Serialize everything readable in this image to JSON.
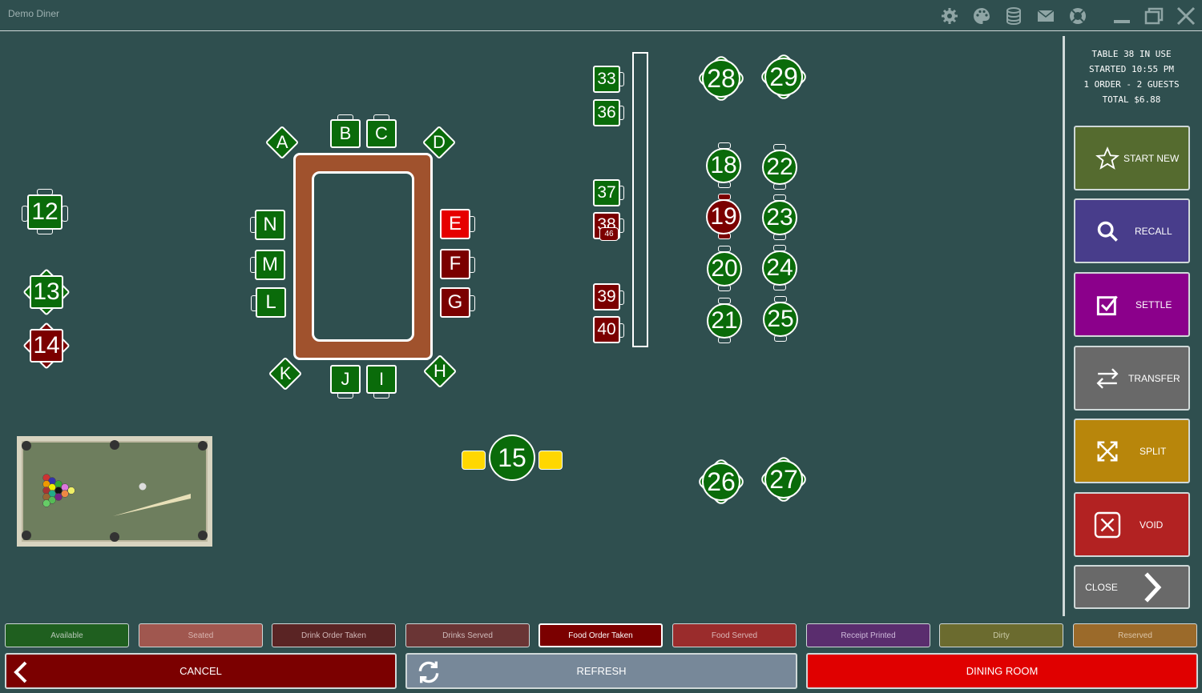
{
  "app": {
    "title": "Demo Diner"
  },
  "titlebar": {
    "icons": [
      "gear-icon",
      "palette-icon",
      "database-icon",
      "mail-icon",
      "lifebuoy-icon",
      "minimize-icon",
      "maximize-icon",
      "close-icon"
    ]
  },
  "floor": {
    "bar_tables": {
      "A": "A",
      "B": "B",
      "C": "C",
      "D": "D",
      "E": "E",
      "F": "F",
      "G": "G",
      "H": "H",
      "I": "I",
      "J": "J",
      "K": "K",
      "L": "L",
      "M": "M",
      "N": "N"
    },
    "tables": {
      "t12": "12",
      "t13": "13",
      "t14": "14",
      "t15": "15",
      "t18": "18",
      "t19": "19",
      "t20": "20",
      "t21": "21",
      "t22": "22",
      "t23": "23",
      "t24": "24",
      "t25": "25",
      "t26": "26",
      "t27": "27",
      "t28": "28",
      "t29": "29",
      "t33": "33",
      "t36": "36",
      "t37": "37",
      "t38": "38",
      "t39": "39",
      "t40": "40"
    },
    "table38_badge": "46"
  },
  "info": {
    "line1": "TABLE 38 IN USE",
    "line2": "STARTED 10:55 PM",
    "line3": "1 ORDER - 2 GUESTS",
    "line4": "TOTAL $6.88"
  },
  "actions": [
    {
      "label": "START NEW",
      "color": "#556b2f",
      "icon": "star-icon"
    },
    {
      "label": "RECALL",
      "color": "#483d8b",
      "icon": "search-icon"
    },
    {
      "label": "SETTLE",
      "color": "#8b008b",
      "icon": "checkbox-icon"
    },
    {
      "label": "TRANSFER",
      "color": "#696969",
      "icon": "transfer-icon"
    },
    {
      "label": "SPLIT",
      "color": "#b8860b",
      "icon": "split-icon"
    },
    {
      "label": "VOID",
      "color": "#b22222",
      "icon": "void-icon"
    },
    {
      "label": "CLOSE",
      "color": "#696969",
      "icon": "chevron-right-icon"
    }
  ],
  "legend": [
    {
      "label": "Available",
      "bg": "#1f5f1f",
      "fg": "#b9c9b9"
    },
    {
      "label": "Seated",
      "bg": "#a0574f",
      "fg": "#d9b5b0"
    },
    {
      "label": "Drink Order Taken",
      "bg": "#5a2424",
      "fg": "#d2b8b8"
    },
    {
      "label": "Drinks Served",
      "bg": "#6a3535",
      "fg": "#d0bcbc"
    },
    {
      "label": "Food Order Taken",
      "bg": "#7b0000",
      "fg": "#ffffff"
    },
    {
      "label": "Food Served",
      "bg": "#9a2c2c",
      "fg": "#dcb8b8"
    },
    {
      "label": "Receipt Printed",
      "bg": "#5a2d6e",
      "fg": "#cfbadb"
    },
    {
      "label": "Dirty",
      "bg": "#6b6b2f",
      "fg": "#c9c9a6"
    },
    {
      "label": "Reserved",
      "bg": "#9b6a2a",
      "fg": "#dcc6a8"
    }
  ],
  "bottom": {
    "cancel": "CANCEL",
    "refresh": "REFRESH",
    "dining_room": "DINING ROOM"
  }
}
